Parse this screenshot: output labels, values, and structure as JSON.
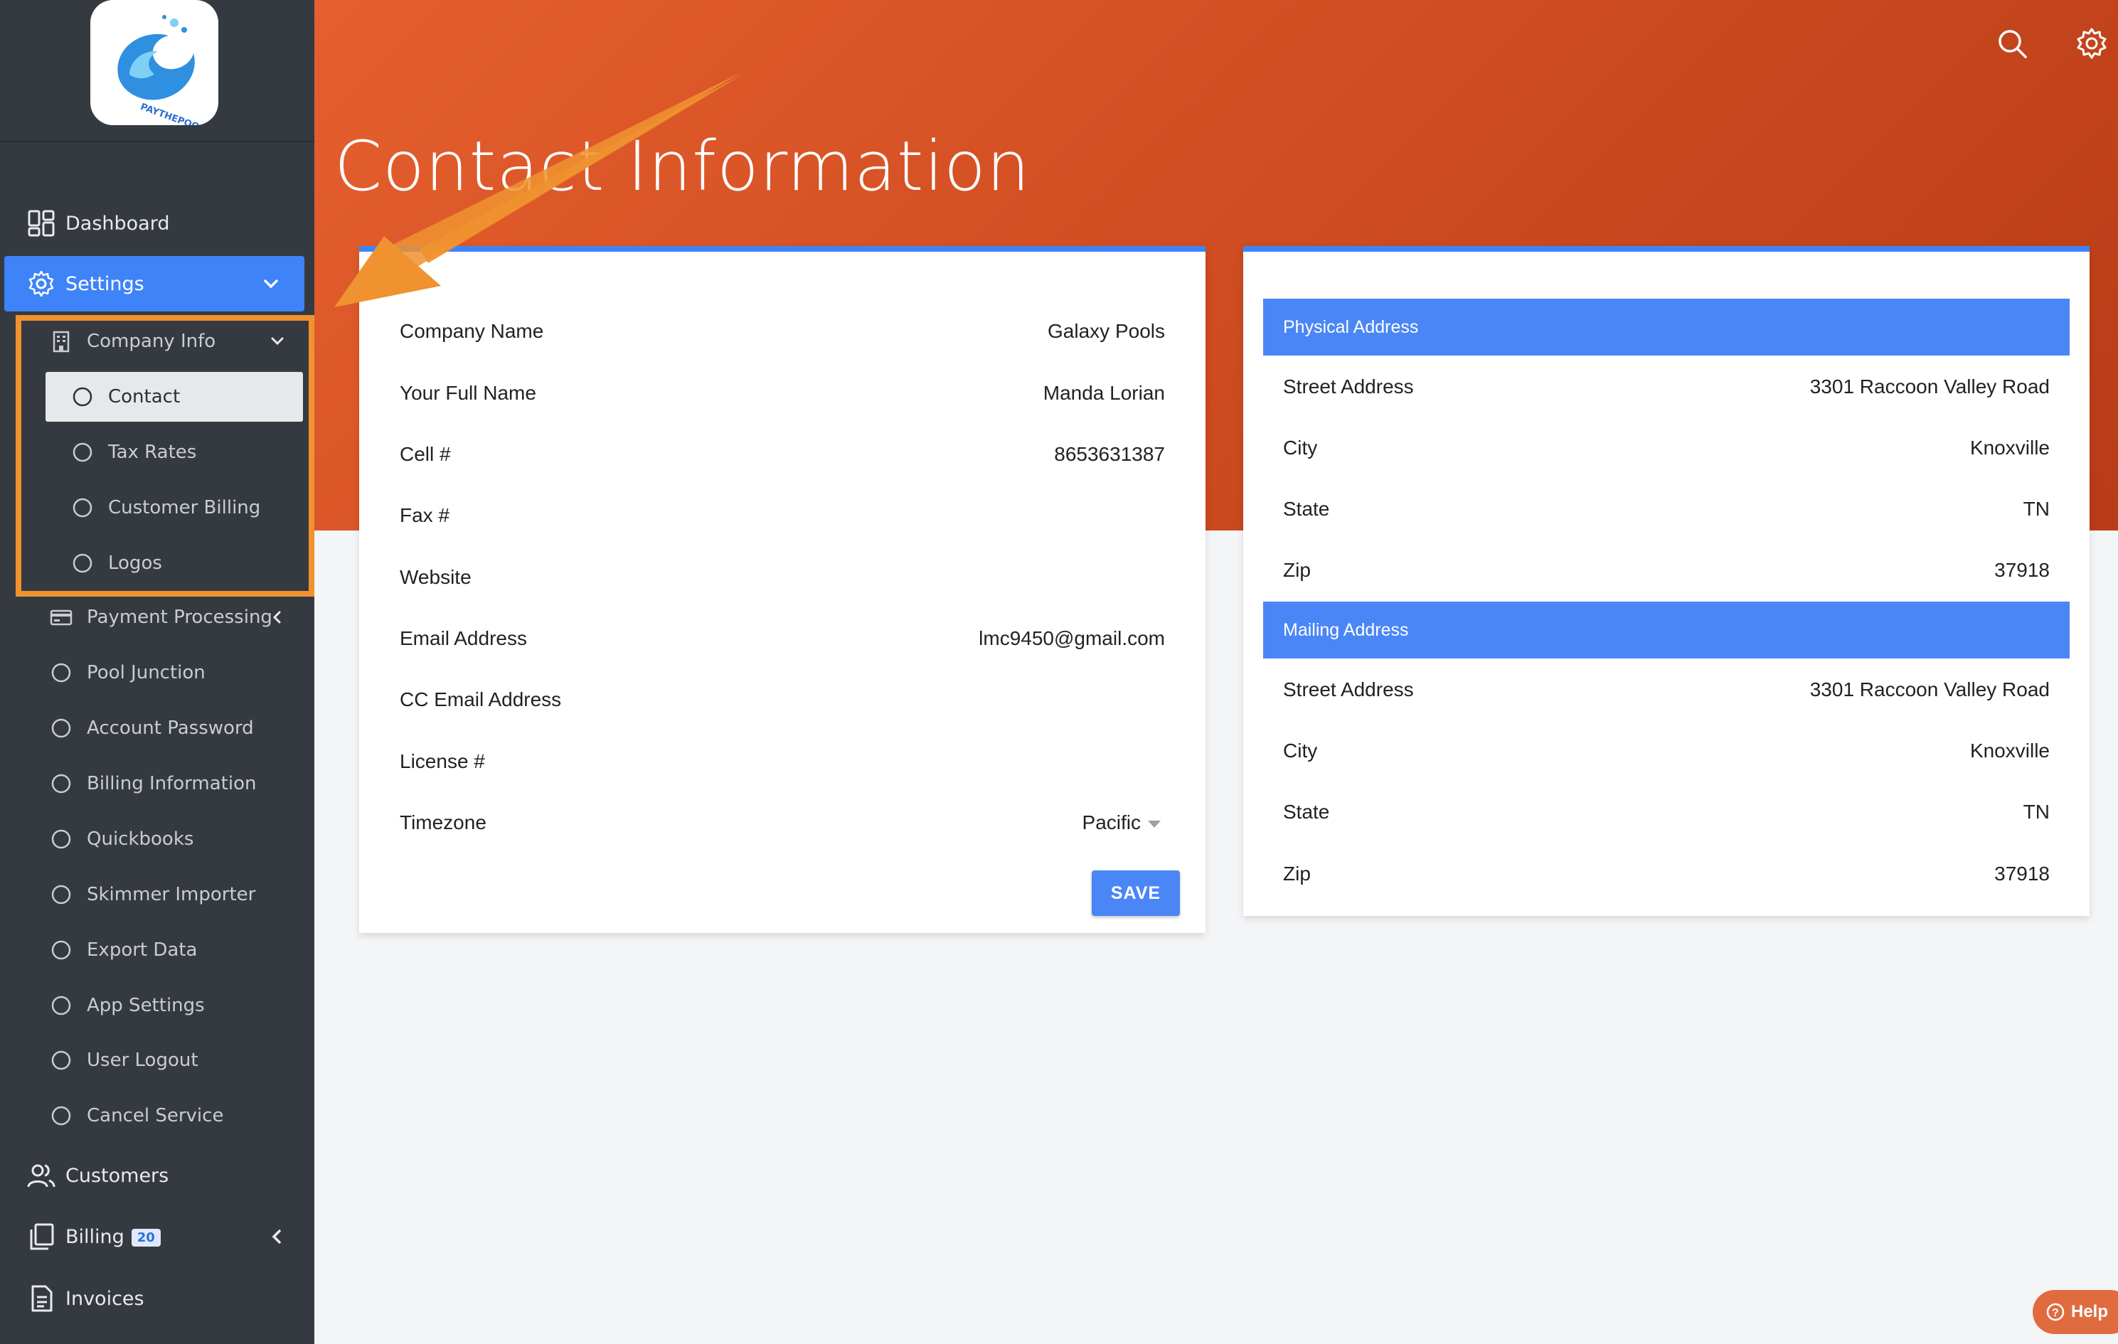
{
  "app": {
    "logo_text": "PAYTHEPOOLMAN",
    "page_title": "Contact Information"
  },
  "sidebar": {
    "items": [
      {
        "label": "Dashboard",
        "icon": "dashboard-icon"
      },
      {
        "label": "Settings",
        "icon": "gear-icon"
      },
      {
        "label": "Customers",
        "icon": "users-icon"
      },
      {
        "label": "Billing",
        "icon": "billing-icon",
        "badge": "20"
      },
      {
        "label": "Invoices",
        "icon": "document-icon"
      }
    ],
    "settings_children": [
      {
        "label": "Company Info",
        "icon": "building-icon"
      },
      {
        "label": "Payment Processing",
        "icon": "credit-card-icon"
      },
      {
        "label": "Pool Junction",
        "icon": "circle-icon"
      },
      {
        "label": "Account Password",
        "icon": "circle-icon"
      },
      {
        "label": "Billing Information",
        "icon": "circle-icon"
      },
      {
        "label": "Quickbooks",
        "icon": "circle-icon"
      },
      {
        "label": "Skimmer Importer",
        "icon": "circle-icon"
      },
      {
        "label": "Export Data",
        "icon": "circle-icon"
      },
      {
        "label": "App Settings",
        "icon": "circle-icon"
      },
      {
        "label": "User Logout",
        "icon": "circle-icon"
      },
      {
        "label": "Cancel Service",
        "icon": "circle-icon"
      }
    ],
    "company_info_children": [
      {
        "label": "Contact"
      },
      {
        "label": "Tax Rates"
      },
      {
        "label": "Customer Billing"
      },
      {
        "label": "Logos"
      }
    ]
  },
  "contact_form": {
    "rows": [
      {
        "label": "Company Name",
        "value": "Galaxy Pools"
      },
      {
        "label": "Your Full Name",
        "value": "Manda Lorian"
      },
      {
        "label": "Cell #",
        "value": "8653631387"
      },
      {
        "label": "Fax #",
        "value": ""
      },
      {
        "label": "Website",
        "value": ""
      },
      {
        "label": "Email Address",
        "value": "lmc9450@gmail.com"
      },
      {
        "label": "CC Email Address",
        "value": ""
      },
      {
        "label": "License #",
        "value": ""
      },
      {
        "label": "Timezone",
        "value": "Pacific"
      }
    ],
    "save_label": "SAVE"
  },
  "addresses": {
    "physical": {
      "title": "Physical Address",
      "rows": [
        {
          "label": "Street Address",
          "value": "3301 Raccoon Valley Road"
        },
        {
          "label": "City",
          "value": "Knoxville"
        },
        {
          "label": "State",
          "value": "TN"
        },
        {
          "label": "Zip",
          "value": "37918"
        }
      ]
    },
    "mailing": {
      "title": "Mailing Address",
      "rows": [
        {
          "label": "Street Address",
          "value": "3301 Raccoon Valley Road"
        },
        {
          "label": "City",
          "value": "Knoxville"
        },
        {
          "label": "State",
          "value": "TN"
        },
        {
          "label": "Zip",
          "value": "37918"
        }
      ]
    }
  },
  "help": {
    "label": "Help"
  },
  "colors": {
    "sidebar_bg": "#353a41",
    "accent_blue": "#3f83f8",
    "header_orange": "#d24e22",
    "annotation_orange": "#f0922f"
  }
}
